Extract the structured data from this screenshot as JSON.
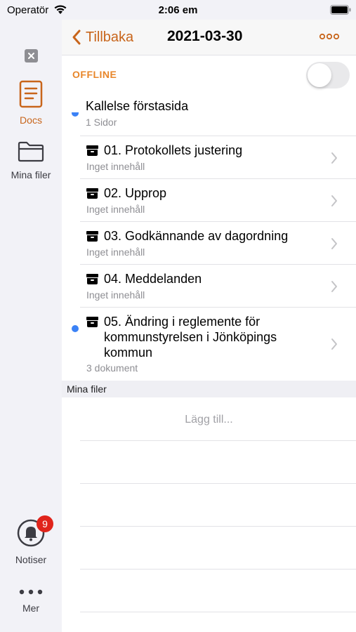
{
  "status_bar": {
    "carrier": "Operatör",
    "time": "2:06 em"
  },
  "rail": {
    "docs_label": "Docs",
    "files_label": "Mina filer",
    "notifications_label": "Notiser",
    "notifications_badge": "9",
    "more_label": "Mer"
  },
  "nav": {
    "back_label": "Tillbaka",
    "title": "2021-03-30"
  },
  "offline": {
    "label": "OFFLINE",
    "enabled": false
  },
  "cover": {
    "title": "Kallelse förstasida",
    "subtitle": "1 Sidor"
  },
  "items": [
    {
      "title": "01. Protokollets justering",
      "subtitle": "Inget innehåll"
    },
    {
      "title": "02. Upprop",
      "subtitle": "Inget innehåll"
    },
    {
      "title": "03. Godkännande av dagordning",
      "subtitle": "Inget innehåll"
    },
    {
      "title": "04. Meddelanden",
      "subtitle": "Inget innehåll"
    },
    {
      "title": "05. Ändring i reglemente för kommunstyrelsen i Jönköpings kommun",
      "subtitle": "3 dokument"
    }
  ],
  "my_files": {
    "header": "Mina filer",
    "add_label": "Lägg till..."
  },
  "colors": {
    "accent": "#c8651b",
    "offline": "#e8862a",
    "unread_dot": "#3b82f6",
    "badge": "#e0241b"
  }
}
